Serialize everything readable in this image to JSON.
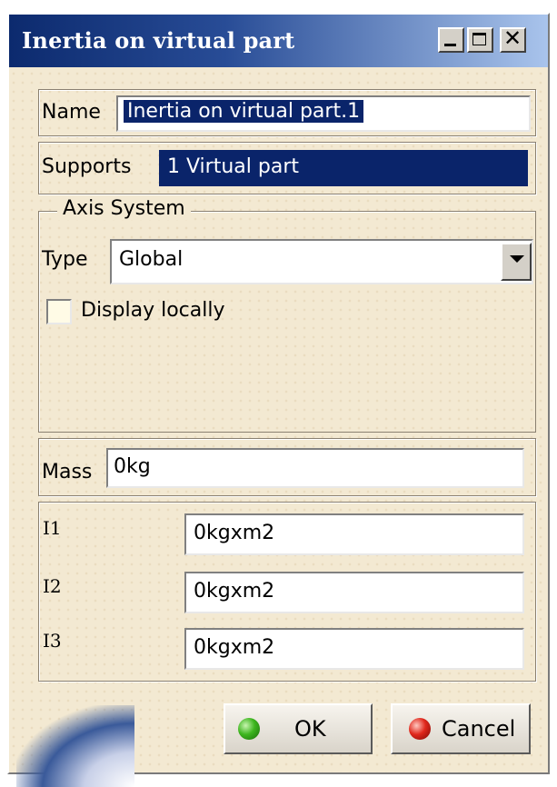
{
  "window": {
    "title": "Inertia on virtual part"
  },
  "name_row": {
    "label": "Name",
    "value": "Inertia on virtual part.1"
  },
  "supports_row": {
    "label": "Supports",
    "value": "1 Virtual part"
  },
  "axis_system": {
    "legend": "Axis System",
    "type_label": "Type",
    "type_value": "Global",
    "display_locally_label": "Display locally",
    "display_locally_checked": false
  },
  "mass_row": {
    "label": "Mass",
    "value": "0kg"
  },
  "inertia": {
    "i1_label": "I1",
    "i1_value": "0kgxm2",
    "i2_label": "I2",
    "i2_value": "0kgxm2",
    "i3_label": "I3",
    "i3_value": "0kgxm2"
  },
  "buttons": {
    "ok_label": "OK",
    "cancel_label": "Cancel"
  },
  "icons": {
    "ok": "green-ball-icon",
    "cancel": "red-ball-icon"
  },
  "colors": {
    "selection": "#0a246a",
    "dialog_bg": "#f3e9d2",
    "title_gradient_start": "#0c2a6e"
  }
}
